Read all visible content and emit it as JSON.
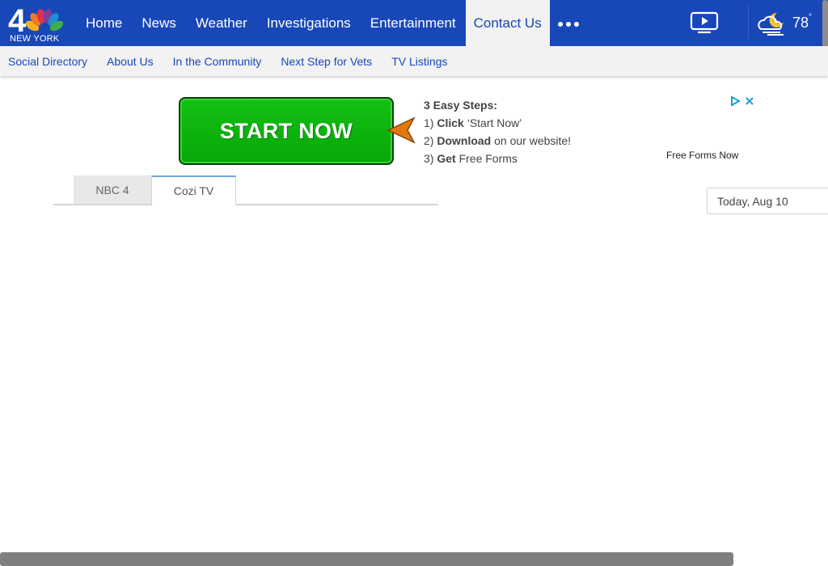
{
  "logo": {
    "station_number": "4",
    "city": "NEW YORK"
  },
  "nav": {
    "items": [
      {
        "label": "Home"
      },
      {
        "label": "News"
      },
      {
        "label": "Weather"
      },
      {
        "label": "Investigations"
      },
      {
        "label": "Entertainment"
      },
      {
        "label": "Contact Us",
        "active": true
      }
    ],
    "more_icon": "more-dots-icon",
    "tv_icon": "tv-play-icon",
    "weather_icon": "partly-cloudy-night-icon",
    "temperature": "78",
    "temperature_unit": "°"
  },
  "subnav": {
    "items": [
      {
        "label": "Social Directory"
      },
      {
        "label": "About Us"
      },
      {
        "label": "In the Community"
      },
      {
        "label": "Next Step for Vets"
      },
      {
        "label": "TV Listings"
      }
    ]
  },
  "ad": {
    "button_label": "START NOW",
    "steps_title": "3 Easy Steps:",
    "step1_num": "1)",
    "step1_bold": "Click",
    "step1_rest": " ‘Start Now’",
    "step2_num": "2)",
    "step2_bold": "Download",
    "step2_rest": " on our website!",
    "step3_num": "3)",
    "step3_bold": "Get",
    "step3_rest": " Free Forms",
    "source": "Free Forms Now",
    "adchoices_icon": "adchoices-icon",
    "close_icon": "close-icon"
  },
  "tabs": [
    {
      "label": "NBC 4"
    },
    {
      "label": "Cozi TV",
      "active": true
    }
  ],
  "date_picker": {
    "value": "Today, Aug 10"
  },
  "colors": {
    "brand_blue": "#1847b8",
    "subnav_bg": "#f2f2f2",
    "ad_green": "#12c012",
    "ad_arrow": "#e07a10"
  }
}
